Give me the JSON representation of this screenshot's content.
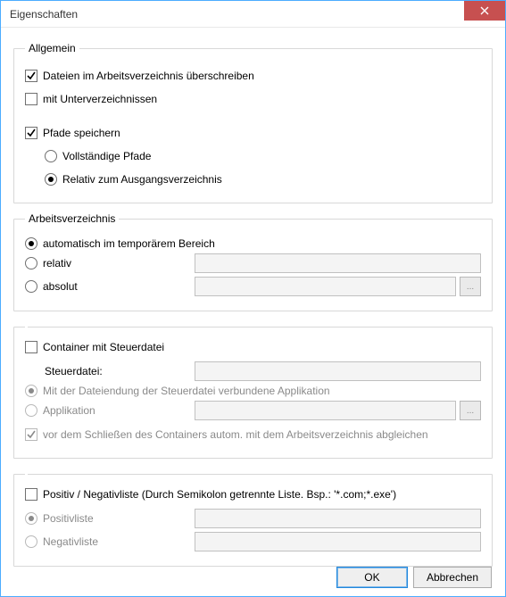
{
  "window": {
    "title": "Eigenschaften"
  },
  "groups": {
    "allgemein": {
      "legend": "Allgemein",
      "overwrite": {
        "label": "Dateien im Arbeitsverzeichnis überschreiben",
        "checked": true
      },
      "subdirs": {
        "label": "mit Unterverzeichnissen",
        "checked": false
      },
      "savepaths": {
        "label": "Pfade speichern",
        "checked": true
      },
      "pathmode": {
        "full": "Vollständige Pfade",
        "relative": "Relativ zum Ausgangsverzeichnis",
        "selected": "relative"
      }
    },
    "workdir": {
      "legend": "Arbeitsverzeichnis",
      "auto": {
        "label": "automatisch im temporärem Bereich"
      },
      "relative": {
        "label": "relativ",
        "value": ""
      },
      "absolute": {
        "label": "absolut",
        "value": ""
      },
      "selected": "auto",
      "browse_label": "..."
    },
    "container": {
      "enable": {
        "label": "Container mit Steuerdatei",
        "checked": false
      },
      "filelabel": "Steuerdatei:",
      "file": "",
      "assoc": {
        "label": "Mit der Dateiendung der Steuerdatei verbundene Applikation"
      },
      "app": {
        "label": "Applikation",
        "value": ""
      },
      "appmode_selected": "assoc",
      "sync": {
        "label": "vor dem Schließen des Containers autom. mit dem Arbeitsverzeichnis abgleichen",
        "checked": true
      },
      "browse_label": "..."
    },
    "posneg": {
      "enable": {
        "label": "Positiv / Negativliste (Durch Semikolon getrennte Liste. Bsp.: '*.com;*.exe')",
        "checked": false
      },
      "positive": {
        "label": "Positivliste",
        "value": ""
      },
      "negative": {
        "label": "Negativliste",
        "value": ""
      },
      "selected": "positive"
    }
  },
  "buttons": {
    "ok": "OK",
    "cancel": "Abbrechen"
  }
}
